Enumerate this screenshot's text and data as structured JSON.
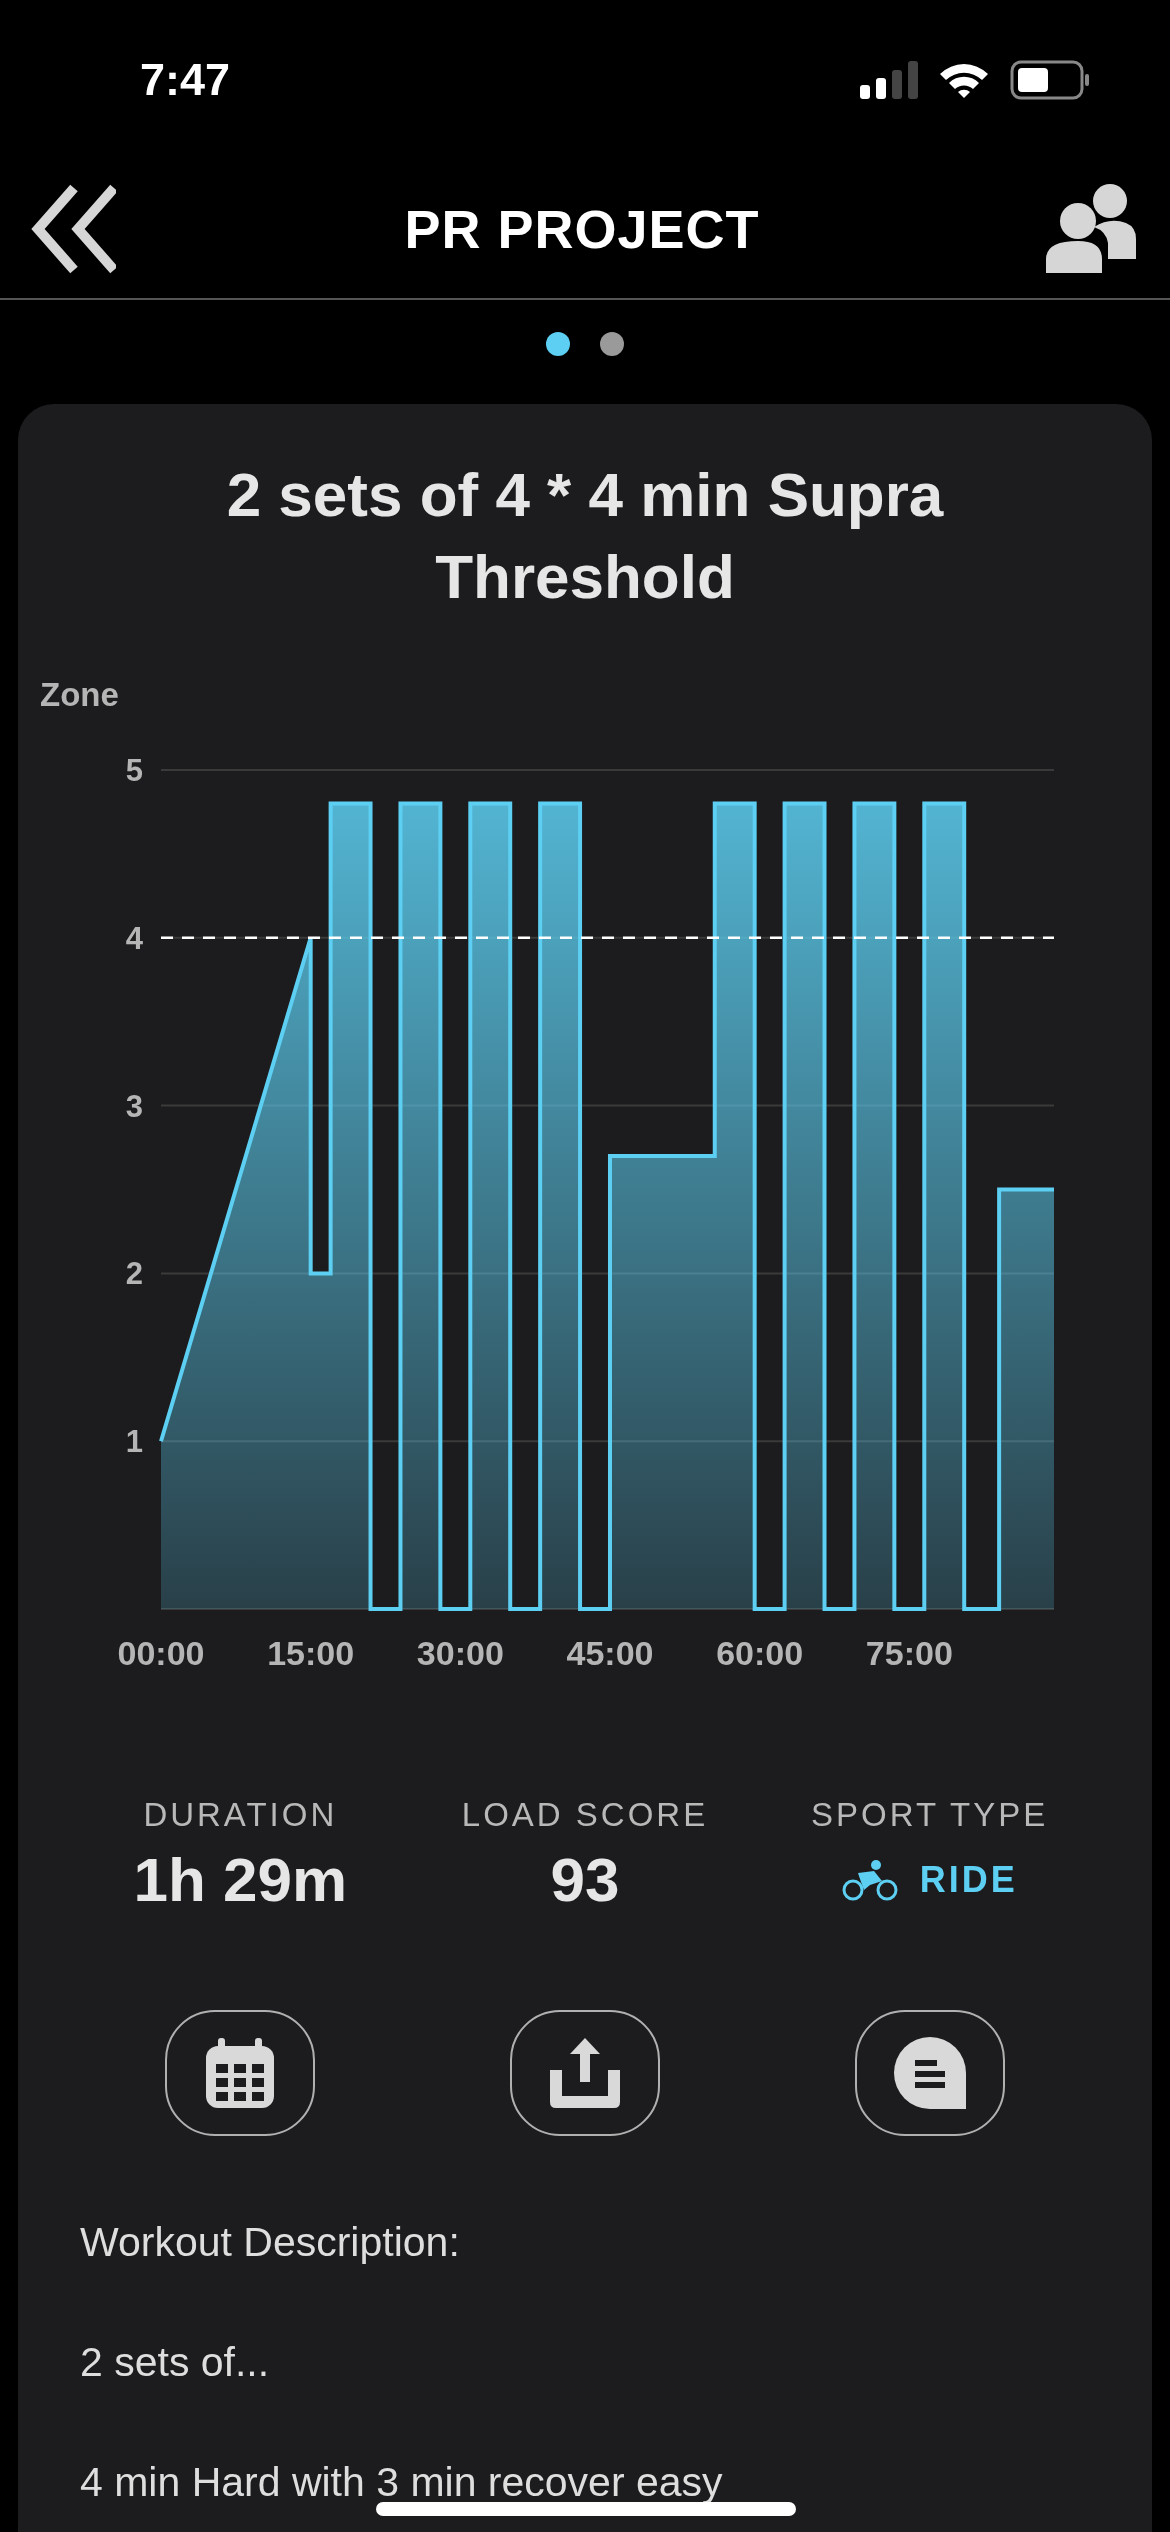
{
  "status_bar": {
    "time": "7:47"
  },
  "header": {
    "title": "PR PROJECT"
  },
  "pager": [
    {
      "selected": true
    },
    {
      "selected": false
    }
  ],
  "workout": {
    "title": "2 sets of 4 * 4 min Supra Threshold",
    "chart_data": {
      "type": "area",
      "ylabel": "Zone",
      "xlim": [
        0,
        89.5
      ],
      "ylim": [
        0,
        5
      ],
      "xticks": [
        {
          "value": 0,
          "label": "00:00"
        },
        {
          "value": 15,
          "label": "15:00"
        },
        {
          "value": 30,
          "label": "30:00"
        },
        {
          "value": 45,
          "label": "45:00"
        },
        {
          "value": 60,
          "label": "60:00"
        },
        {
          "value": 75,
          "label": "75:00"
        }
      ],
      "yticks": [
        1,
        2,
        3,
        4,
        5
      ],
      "x": [
        0,
        15,
        15,
        17,
        17,
        21,
        21,
        24,
        24,
        28,
        28,
        31,
        31,
        35,
        35,
        38,
        38,
        42,
        42,
        45,
        45,
        55.5,
        55.5,
        59.5,
        59.5,
        62.5,
        62.5,
        66.5,
        66.5,
        69.5,
        69.5,
        73.5,
        73.5,
        76.5,
        76.5,
        80.5,
        80.5,
        84,
        84,
        89.5
      ],
      "series": [
        {
          "color": "#5ccff2",
          "values": [
            1,
            4,
            2,
            2,
            4.8,
            4.8,
            0,
            0,
            4.8,
            4.8,
            0,
            0,
            4.8,
            4.8,
            0,
            0,
            4.8,
            4.8,
            0,
            0,
            2.7,
            2.7,
            4.8,
            4.8,
            0,
            0,
            4.8,
            4.8,
            0,
            0,
            4.8,
            4.8,
            0,
            0,
            4.8,
            4.8,
            0,
            0,
            2.5,
            2.5
          ]
        }
      ],
      "grid": true,
      "ref_lines": [
        {
          "axis": "y",
          "value": 4
        }
      ]
    },
    "stats": [
      {
        "kind": "text",
        "label": "DURATION",
        "value": "1h 29m"
      },
      {
        "kind": "text",
        "label": "LOAD SCORE",
        "value": "93"
      },
      {
        "kind": "sport",
        "label": "SPORT TYPE",
        "value": "RIDE"
      }
    ],
    "actions": [
      {
        "kind": "calendar"
      },
      {
        "kind": "share"
      },
      {
        "kind": "comment"
      }
    ],
    "description": [
      "Workout Description:",
      "2 sets of...",
      "4 min Hard with 3 min recover easy"
    ]
  }
}
